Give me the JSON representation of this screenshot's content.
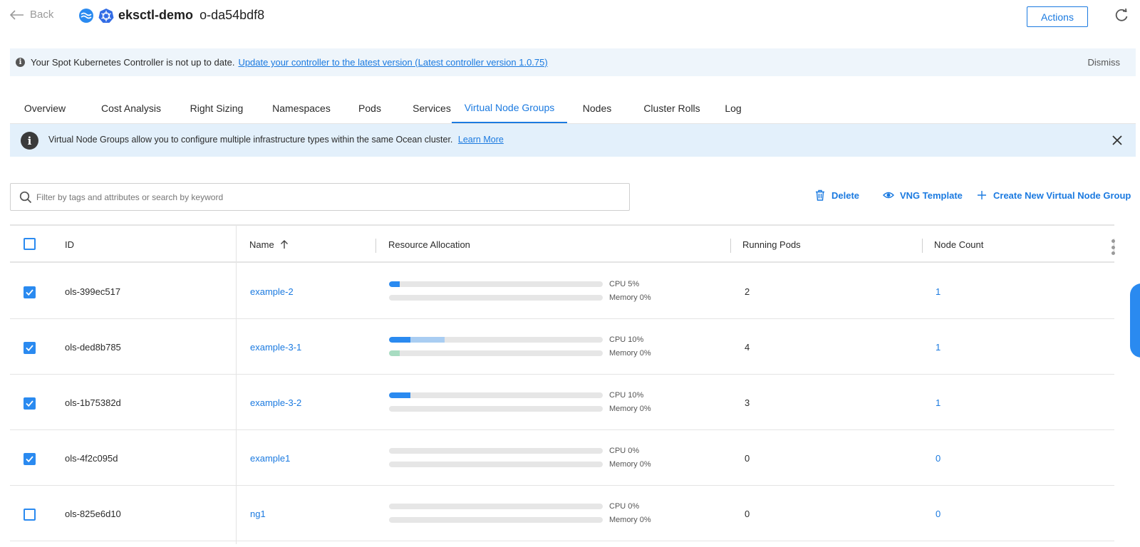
{
  "header": {
    "back_label": "Back",
    "cluster_name": "eksctl-demo",
    "cluster_id": "o-da54bdf8",
    "actions_label": "Actions"
  },
  "update_banner": {
    "message": "Your Spot Kubernetes Controller is not up to date.",
    "link": "Update your controller to the latest version (Latest controller version 1.0.75)",
    "dismiss": "Dismiss"
  },
  "tabs": [
    {
      "label": "Overview"
    },
    {
      "label": "Cost Analysis"
    },
    {
      "label": "Right Sizing"
    },
    {
      "label": "Namespaces"
    },
    {
      "label": "Pods"
    },
    {
      "label": "Services"
    },
    {
      "label": "Virtual Node Groups"
    },
    {
      "label": "Nodes"
    },
    {
      "label": "Cluster Rolls"
    },
    {
      "label": "Log"
    }
  ],
  "active_tab": "Virtual Node Groups",
  "vng_banner": {
    "message": "Virtual Node Groups allow you to configure multiple infrastructure types within the same Ocean cluster.",
    "link": "Learn More"
  },
  "search": {
    "placeholder": "Filter by tags and attributes or search by keyword",
    "value": ""
  },
  "toolbar": {
    "delete_label": "Delete",
    "template_label": "VNG Template",
    "create_label": "Create New Virtual Node Group"
  },
  "table": {
    "columns": {
      "id": "ID",
      "name": "Name",
      "resource": "Resource Allocation",
      "pods": "Running Pods",
      "nodes": "Node Count"
    },
    "rows": [
      {
        "checked": true,
        "id": "ols-399ec517",
        "name": "example-2",
        "cpu_label": "CPU 5%",
        "mem_label": "Memory 0%",
        "cpu_used": 0.05,
        "cpu_requested": 0.05,
        "mem_used": 0.0,
        "pods": "2",
        "nodes": "1"
      },
      {
        "checked": true,
        "id": "ols-ded8b785",
        "name": "example-3-1",
        "cpu_label": "CPU 10%",
        "mem_label": "Memory 0%",
        "cpu_used": 0.1,
        "cpu_requested": 0.26,
        "mem_used": 0.05,
        "pods": "4",
        "nodes": "1"
      },
      {
        "checked": true,
        "id": "ols-1b75382d",
        "name": "example-3-2",
        "cpu_label": "CPU 10%",
        "mem_label": "Memory 0%",
        "cpu_used": 0.1,
        "cpu_requested": 0.1,
        "mem_used": 0.0,
        "pods": "3",
        "nodes": "1"
      },
      {
        "checked": true,
        "id": "ols-4f2c095d",
        "name": "example1",
        "cpu_label": "CPU 0%",
        "mem_label": "Memory 0%",
        "cpu_used": 0.0,
        "cpu_requested": 0.0,
        "mem_used": 0.0,
        "pods": "0",
        "nodes": "0"
      },
      {
        "checked": false,
        "id": "ols-825e6d10",
        "name": "ng1",
        "cpu_label": "CPU 0%",
        "mem_label": "Memory 0%",
        "cpu_used": 0.0,
        "cpu_requested": 0.0,
        "mem_used": 0.0,
        "pods": "0",
        "nodes": "0"
      }
    ]
  },
  "colors": {
    "accent": "#1b7ae0",
    "checkbox": "#2a8af0",
    "cpu_requested": "#a9cdf2",
    "memory": "#a7dcc1"
  }
}
